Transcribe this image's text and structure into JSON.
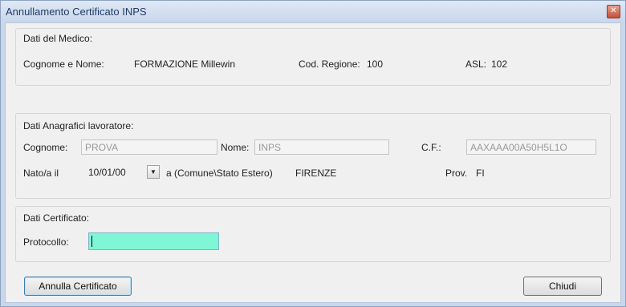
{
  "window": {
    "title": "Annullamento Certificato INPS",
    "close_glyph": "✕"
  },
  "medico": {
    "section_title": "Dati del Medico:",
    "name_label": "Cognome e Nome:",
    "name_value": "FORMAZIONE Millewin",
    "region_label": "Cod. Regione:",
    "region_value": "100",
    "asl_label": "ASL:",
    "asl_value": "102"
  },
  "lavoratore": {
    "section_title": "Dati Anagrafici lavoratore:",
    "cognome_label": "Cognome:",
    "cognome_value": "PROVA",
    "nome_label": "Nome:",
    "nome_value": "INPS",
    "cf_label": "C.F.:",
    "cf_value": "AAXAAA00A50H5L1O",
    "nato_label": "Nato/a il",
    "nato_value": "10/01/00",
    "comune_label": "a (Comune\\Stato Estero)",
    "comune_value": "FIRENZE",
    "prov_label": "Prov.",
    "prov_value": "FI"
  },
  "certificato": {
    "section_title": "Dati Certificato:",
    "protocollo_label": "Protocollo:",
    "protocollo_value": ""
  },
  "buttons": {
    "annulla_label": "Annulla Certificato",
    "chiudi_label": "Chiudi"
  },
  "icons": {
    "close": "close-icon",
    "dropdown": "chevron-down-icon"
  },
  "colors": {
    "active_input": "#7ff6d6",
    "titlebar": "#c9d7ea"
  }
}
